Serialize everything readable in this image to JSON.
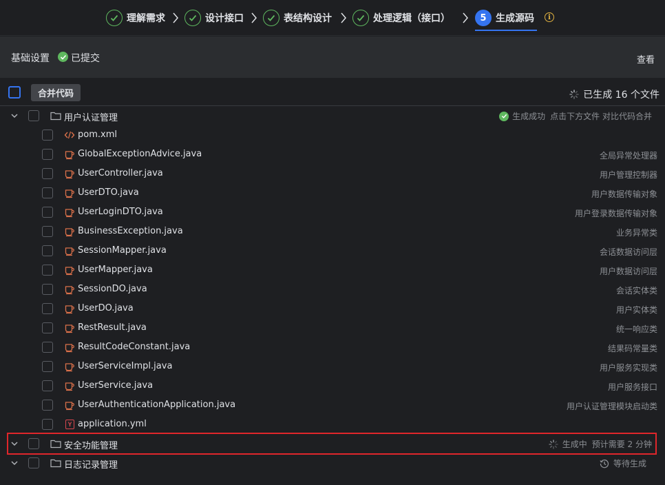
{
  "stepper": {
    "steps": [
      {
        "label": "理解需求",
        "state": "done"
      },
      {
        "label": "设计接口",
        "state": "done"
      },
      {
        "label": "表结构设计",
        "state": "done"
      },
      {
        "label": "处理逻辑（接口）",
        "state": "done"
      },
      {
        "label": "生成源码",
        "state": "active",
        "number": "5"
      }
    ],
    "info_icon": "i"
  },
  "settings": {
    "title": "基础设置",
    "status": "已提交",
    "view_link": "查看"
  },
  "toolbar": {
    "merge_button": "合并代码",
    "generated_count": "已生成 16 个文件"
  },
  "groups": [
    {
      "name": "用户认证管理",
      "status_label": "生成成功",
      "hint": "点击下方文件 对比代码合并",
      "files": [
        {
          "name": "pom.xml",
          "icon": "xml-icon",
          "desc": ""
        },
        {
          "name": "GlobalExceptionAdvice.java",
          "icon": "java-icon",
          "desc": "全局异常处理器"
        },
        {
          "name": "UserController.java",
          "icon": "java-icon",
          "desc": "用户管理控制器"
        },
        {
          "name": "UserDTO.java",
          "icon": "java-icon",
          "desc": "用户数据传输对象"
        },
        {
          "name": "UserLoginDTO.java",
          "icon": "java-icon",
          "desc": "用户登录数据传输对象"
        },
        {
          "name": "BusinessException.java",
          "icon": "java-icon",
          "desc": "业务异常类"
        },
        {
          "name": "SessionMapper.java",
          "icon": "java-icon",
          "desc": "会话数据访问层"
        },
        {
          "name": "UserMapper.java",
          "icon": "java-icon",
          "desc": "用户数据访问层"
        },
        {
          "name": "SessionDO.java",
          "icon": "java-icon",
          "desc": "会话实体类"
        },
        {
          "name": "UserDO.java",
          "icon": "java-icon",
          "desc": "用户实体类"
        },
        {
          "name": "RestResult.java",
          "icon": "java-icon",
          "desc": "统一响应类"
        },
        {
          "name": "ResultCodeConstant.java",
          "icon": "java-icon",
          "desc": "结果码常量类"
        },
        {
          "name": "UserServiceImpl.java",
          "icon": "java-icon",
          "desc": "用户服务实现类"
        },
        {
          "name": "UserService.java",
          "icon": "java-icon",
          "desc": "用户服务接口"
        },
        {
          "name": "UserAuthenticationApplication.java",
          "icon": "java-icon",
          "desc": "用户认证管理模块启动类"
        },
        {
          "name": "application.yml",
          "icon": "yml-icon",
          "yml_letter": "Y",
          "desc": ""
        }
      ]
    },
    {
      "name": "安全功能管理",
      "status_label": "生成中",
      "hint": "预计需要 2 分钟"
    },
    {
      "name": "日志记录管理",
      "status_label": "等待生成"
    }
  ],
  "colors": {
    "accent": "#3574f0",
    "success": "#5fb85f",
    "highlight": "#e0262b"
  }
}
